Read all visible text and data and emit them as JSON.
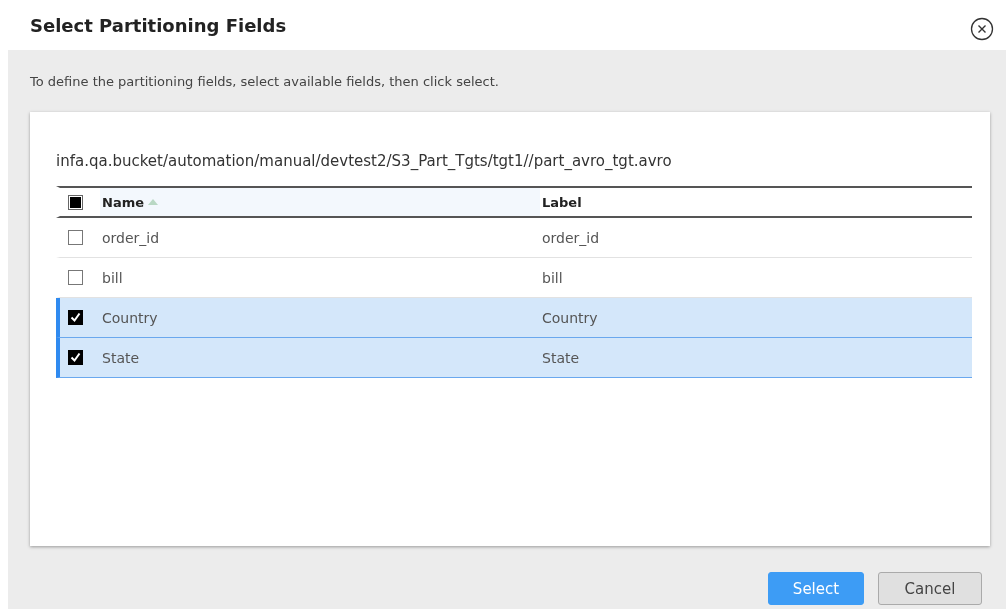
{
  "dialog": {
    "title": "Select Partitioning Fields",
    "description": "To define the partitioning fields, select available fields, then click select.",
    "path": "infa.qa.bucket/automation/manual/devtest2/S3_Part_Tgts/tgt1//part_avro_tgt.avro"
  },
  "table": {
    "select_all": {
      "indeterminate": true
    },
    "columns": [
      {
        "label": "Name",
        "sorted": true
      },
      {
        "label": "Label",
        "sorted": false
      }
    ],
    "rows": [
      {
        "name": "order_id",
        "label": "order_id",
        "selected": false
      },
      {
        "name": "bill",
        "label": "bill",
        "selected": false
      },
      {
        "name": "Country",
        "label": "Country",
        "selected": true
      },
      {
        "name": "State",
        "label": "State",
        "selected": true
      }
    ]
  },
  "buttons": [
    {
      "label": "Select",
      "kind": "primary"
    },
    {
      "label": "Cancel",
      "kind": "secondary"
    }
  ]
}
